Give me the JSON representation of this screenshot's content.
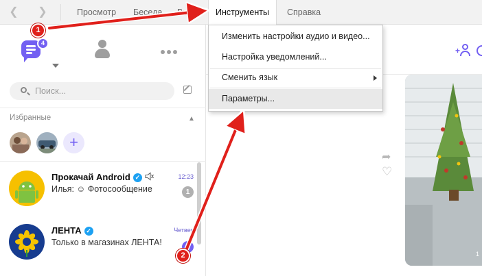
{
  "menubar": {
    "back_icon": "chevron-left-icon",
    "forward_icon": "chevron-right-icon",
    "items": [
      {
        "label": "Просмотр"
      },
      {
        "label": "Беседа"
      },
      {
        "label": "Вызов"
      },
      {
        "label": "Инструменты"
      },
      {
        "label": "Справка"
      }
    ],
    "active_index": 3
  },
  "tools_menu": {
    "items": [
      {
        "label": "Изменить настройки аудио и видео..."
      },
      {
        "label": "Настройка уведомлений..."
      },
      {
        "label": "Сменить язык"
      },
      {
        "label": "Параметры..."
      }
    ],
    "highlighted_index": 3
  },
  "sidebar": {
    "chats_badge": "4",
    "search_placeholder": "Поиск...",
    "favorites_label": "Избранные",
    "chats": [
      {
        "name": "Прокачай Android",
        "message": "Илья: ☺ Фотосообщение",
        "time": "12:23",
        "unread": "1"
      },
      {
        "name": "ЛЕНТА",
        "message": "Только в магазинах ЛЕНТА!",
        "time": "Четверг",
        "unread": ""
      }
    ]
  },
  "main": {
    "photo_time": "1"
  },
  "annotations": {
    "step1": "1",
    "step2": "2",
    "color": "#e0201b"
  },
  "colors": {
    "accent": "#7360f2",
    "verified": "#1da1f2"
  }
}
